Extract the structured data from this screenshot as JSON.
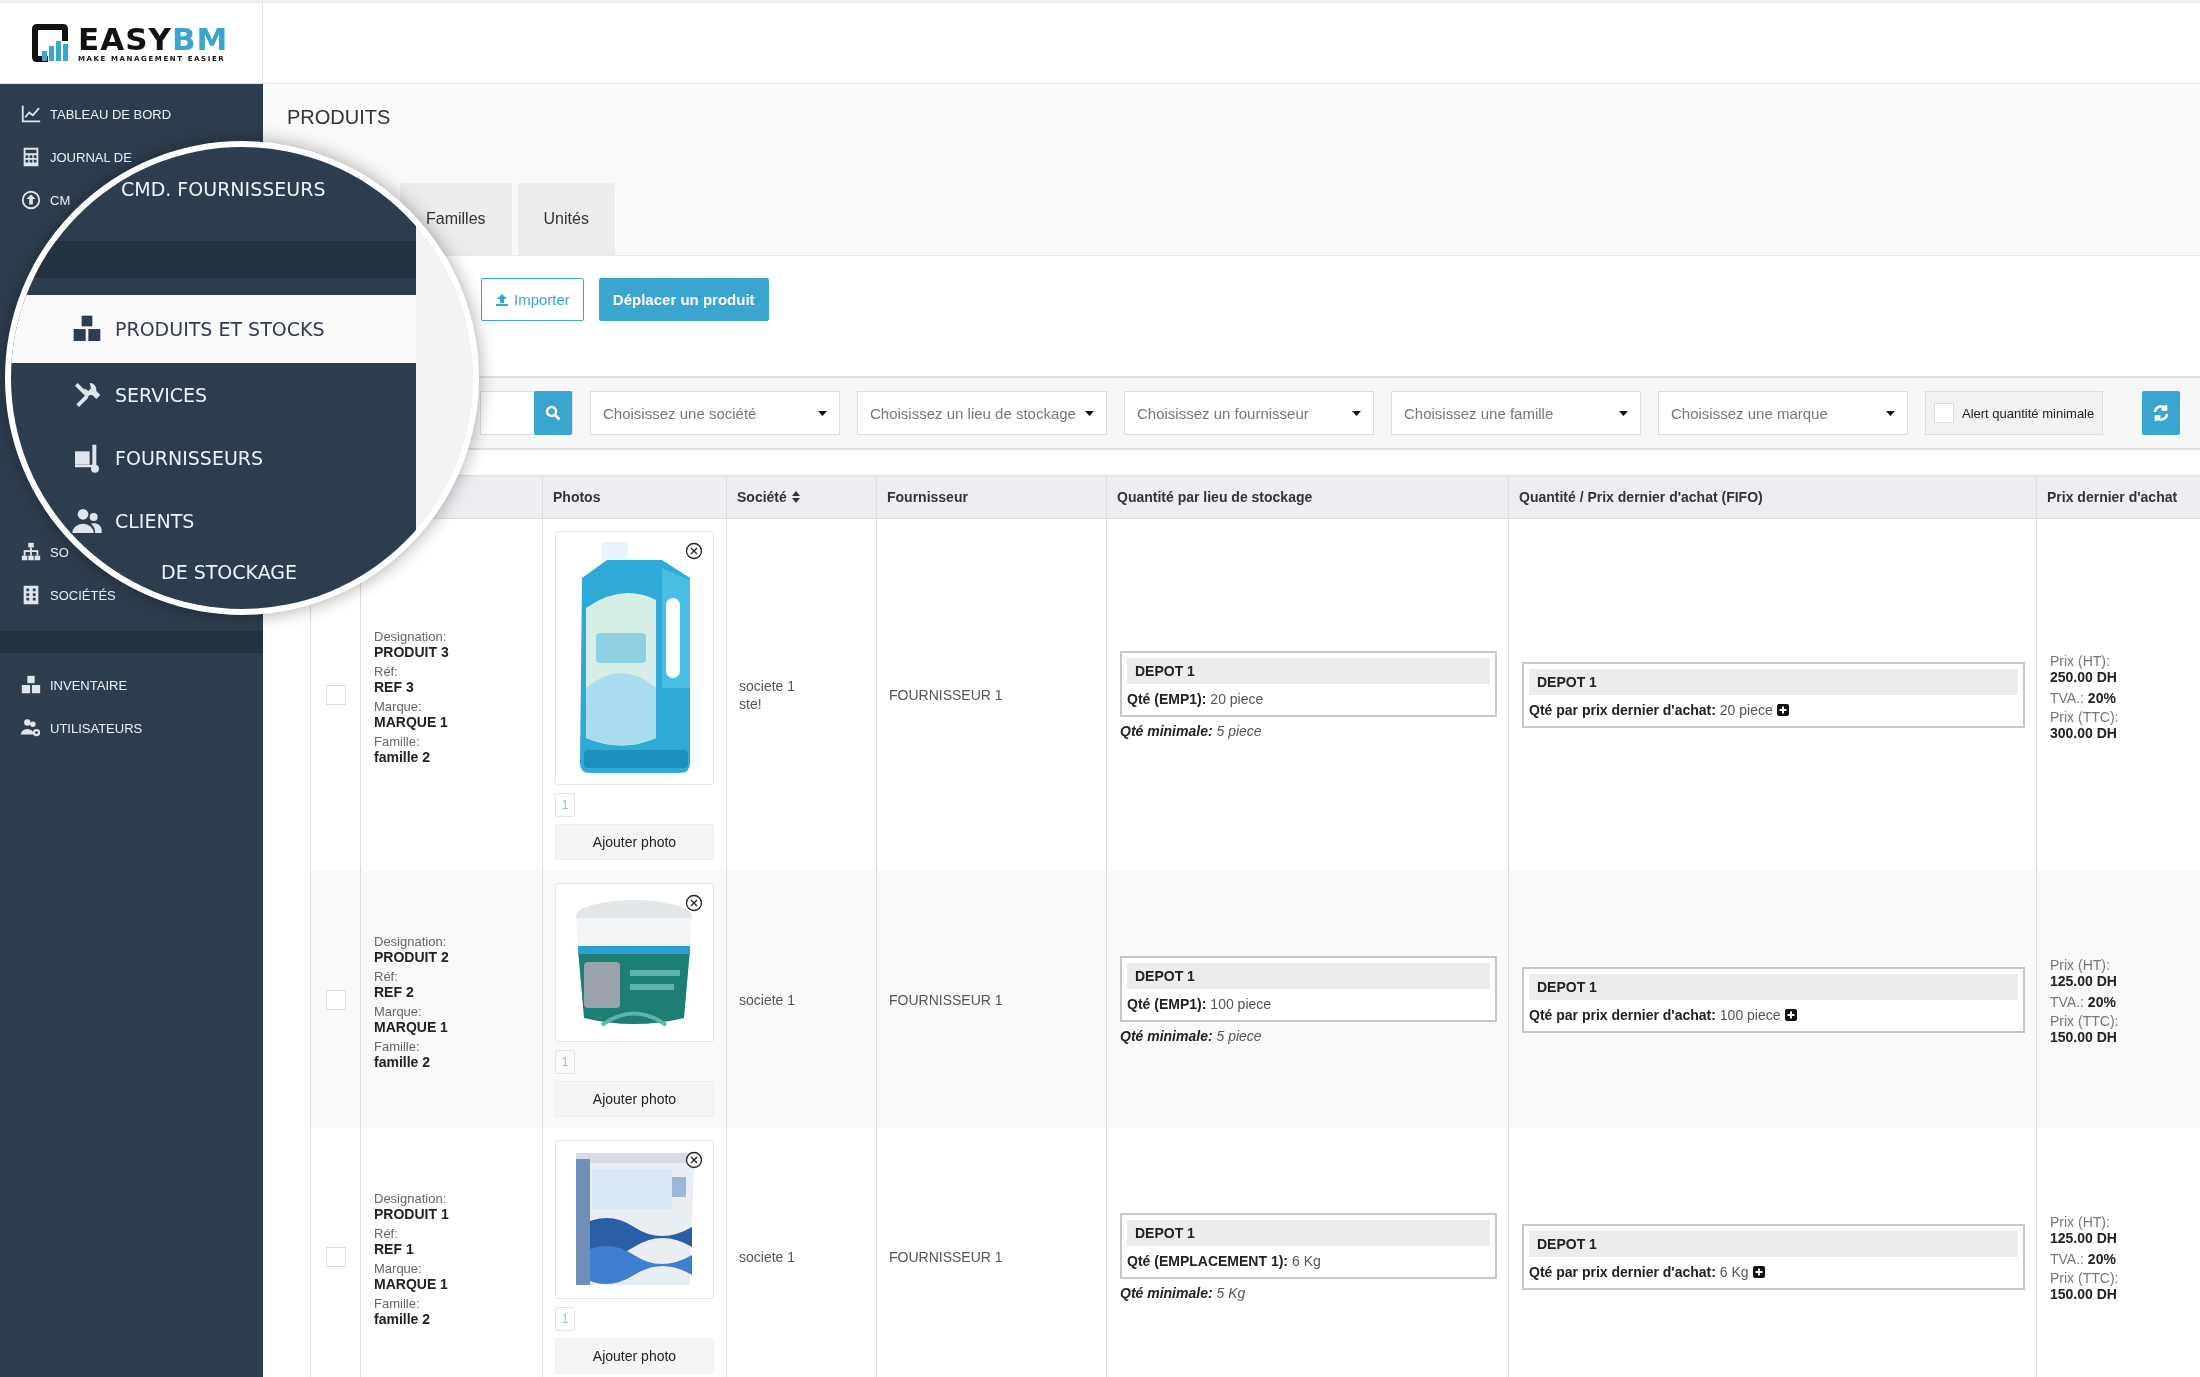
{
  "logo": {
    "name": "EASY",
    "name_accent": "BM",
    "tagline": "MAKE MANAGEMENT EASIER"
  },
  "sidebar": {
    "groups": [
      {
        "items": [
          {
            "label": "TABLEAU DE BORD"
          },
          {
            "label": "JOURNAL DE"
          },
          {
            "label": "CM"
          }
        ]
      },
      {
        "items": [
          {
            "label": "SO"
          },
          {
            "label": "SOCIÉTÉS"
          }
        ]
      },
      {
        "items": [
          {
            "label": "INVENTAIRE"
          },
          {
            "label": "UTILISATEURS"
          }
        ]
      }
    ]
  },
  "magnifier": {
    "items": [
      {
        "label": "CMD. FOURNISSEURS",
        "selected": false
      },
      {
        "label": "PRODUITS ET STOCKS",
        "selected": true
      },
      {
        "label": "SERVICES",
        "selected": false
      },
      {
        "label": "FOURNISSEURS",
        "selected": false
      },
      {
        "label": "CLIENTS",
        "selected": false
      },
      {
        "label": "DE STOCKAGE",
        "selected": false
      }
    ]
  },
  "page_title": "PRODUITS",
  "tabs": [
    {
      "label": "Familles",
      "selected": false
    },
    {
      "label": "Unités",
      "selected": false
    }
  ],
  "actions": [
    {
      "label": "Importer",
      "kind": "outline"
    },
    {
      "label": "Déplacer un produit",
      "kind": "primary"
    }
  ],
  "filters": {
    "selects": [
      "Choisissez une société",
      "Choisissez un lieu de stockage",
      "Choisissez un fournisseur",
      "Choisissez une famille",
      "Choisissez une marque"
    ],
    "alert": {
      "label": "Alert quantité minimale",
      "checked": false
    }
  },
  "table": {
    "columns": [
      {
        "label": "Photos",
        "sortable": false
      },
      {
        "label": "Société",
        "sortable": true
      },
      {
        "label": "Fournisseur",
        "sortable": false
      },
      {
        "label": "Quantité par lieu de stockage",
        "sortable": false
      },
      {
        "label": "Quantité / Prix dernier d'achat (FIFO)",
        "sortable": false
      },
      {
        "label": "Prix dernier d'achat",
        "sortable": false
      }
    ],
    "rows": [
      {
        "selected": false,
        "fields": [
          {
            "label": "Designation:",
            "value": "PRODUIT 3"
          },
          {
            "label": "Réf:",
            "value": "REF 3"
          },
          {
            "label": "Marque:",
            "value": "MARQUE 1"
          },
          {
            "label": "Famille:",
            "value": "famille 2"
          }
        ],
        "photo": {
          "kind": "picture",
          "count": "1",
          "button": "Ajouter photo"
        },
        "societe": [
          "societe 1",
          "ste!"
        ],
        "fournisseur": "FOURNISSEUR 1",
        "stock": {
          "depot": "DEPOT 1",
          "qty_label": "Qté (EMP1):",
          "qty": "20 piece",
          "min_label": "Qté minimale:",
          "min": "5 piece"
        },
        "fifo": {
          "depot": "DEPOT 1",
          "label": "Qté par prix dernier d'achat:",
          "qty": "20 piece"
        },
        "prices": [
          {
            "label": "Prix (HT):",
            "value": "250.00 DH",
            "inline": false
          },
          {
            "label": "TVA.:",
            "value": "20%",
            "inline": true
          },
          {
            "label": "Prix (TTC):",
            "value": "300.00 DH",
            "inline": false
          }
        ]
      },
      {
        "selected": false,
        "fields": [
          {
            "label": "Designation:",
            "value": "PRODUIT 2"
          },
          {
            "label": "Réf:",
            "value": "REF 2"
          },
          {
            "label": "Marque:",
            "value": "MARQUE 1"
          },
          {
            "label": "Famille:",
            "value": "famille 2"
          }
        ],
        "photo": {
          "kind": "picture",
          "count": "1",
          "button": "Ajouter photo"
        },
        "societe": [
          "societe 1"
        ],
        "fournisseur": "FOURNISSEUR 1",
        "stock": {
          "depot": "DEPOT 1",
          "qty_label": "Qté (EMP1):",
          "qty": "100 piece",
          "min_label": "Qté minimale:",
          "min": "5 piece"
        },
        "fifo": {
          "depot": "DEPOT 1",
          "label": "Qté par prix dernier d'achat:",
          "qty": "100 piece"
        },
        "prices": [
          {
            "label": "Prix (HT):",
            "value": "125.00 DH",
            "inline": false
          },
          {
            "label": "TVA.:",
            "value": "20%",
            "inline": true
          },
          {
            "label": "Prix (TTC):",
            "value": "150.00 DH",
            "inline": false
          }
        ]
      },
      {
        "selected": false,
        "fields": [
          {
            "label": "Designation:",
            "value": "PRODUIT 1"
          },
          {
            "label": "Réf:",
            "value": "REF 1"
          },
          {
            "label": "Marque:",
            "value": "MARQUE 1"
          },
          {
            "label": "Famille:",
            "value": "famille 2"
          }
        ],
        "photo": {
          "kind": "picture",
          "count": "1",
          "button": "Ajouter photo"
        },
        "societe": [
          "societe 1"
        ],
        "fournisseur": "FOURNISSEUR 1",
        "stock": {
          "depot": "DEPOT 1",
          "qty_label": "Qté (EMPLACEMENT 1):",
          "qty": "6 Kg",
          "min_label": "Qté minimale:",
          "min": "5 Kg"
        },
        "fifo": {
          "depot": "DEPOT 1",
          "label": "Qté par prix dernier d'achat:",
          "qty": "6 Kg"
        },
        "prices": [
          {
            "label": "Prix (HT):",
            "value": "125.00 DH",
            "inline": false
          },
          {
            "label": "TVA.:",
            "value": "20%",
            "inline": true
          },
          {
            "label": "Prix (TTC):",
            "value": "150.00 DH",
            "inline": false
          }
        ]
      }
    ]
  }
}
